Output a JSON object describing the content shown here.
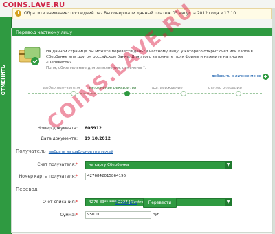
{
  "watermark_top": "COINS.LAVE.RU",
  "watermark_diag": "COINS.LAVE.RU",
  "side_tab": "ОТМЕНИТЬ",
  "notice": {
    "icon": "info-icon",
    "text": "Обратите внимание: последний раз Вы совершали данный платеж 05 августа 2012 года в 17:10"
  },
  "panel": {
    "title": "Перевод частному лицу",
    "intro": "На данной странице Вы можете перевести деньги частному лицу, у которого открыт счет или карта в Сбербанке или другом российском банке. Для этого заполните поля формы и нажмите на кнопку «Перевести».",
    "required_note": "Поля, обязательные для заполнения, отмечены *.",
    "add_link": "добавить в личное меню",
    "add_icon": "plus-icon"
  },
  "steps": [
    {
      "label": "выбор получателя",
      "active": false
    },
    {
      "label": "заполнение реквизитов",
      "active": true
    },
    {
      "label": "подтверждение",
      "active": false
    },
    {
      "label": "статус операции",
      "active": false
    }
  ],
  "document": {
    "number_label": "Номер документа:",
    "number_value": "606912",
    "date_label": "Дата документа:",
    "date_value": "19.10.2012"
  },
  "recipient": {
    "section_title": "Получатель",
    "template_link": "выбрать из шаблонов платежей",
    "account_label": "Счет получателя:",
    "account_value": "на карту Сбербанка",
    "card_label": "Номер карты получателя:",
    "card_value": "4276842015864196"
  },
  "transfer": {
    "section_title": "Перевод",
    "debit_label": "Счет списания:",
    "debit_value": "4276 83** **** 2227  [Electron] 18 665,70  руб.",
    "amount_label": "Сумма:",
    "amount_value": "950.00",
    "amount_unit": "руб."
  },
  "actions": {
    "cancel": "Отменить",
    "submit": "Перевести"
  },
  "colors": {
    "brand_green": "#2f9a41",
    "link": "#0a55a8",
    "watermark": "#dc143c"
  }
}
